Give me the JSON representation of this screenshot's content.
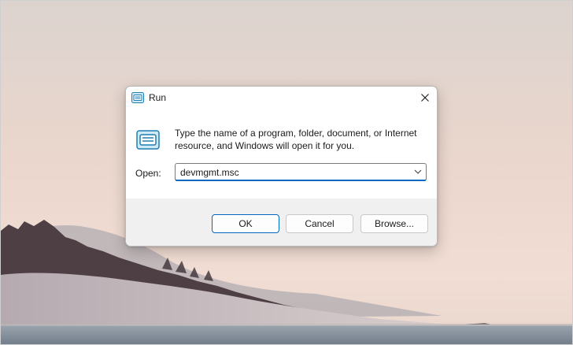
{
  "window": {
    "title": "Run",
    "title_icon": "run-icon",
    "close_icon": "close-icon"
  },
  "dialog": {
    "prompt": "Type the name of a program, folder, document, or Internet resource, and Windows will open it for you.",
    "icon": "run-icon",
    "open_label": "Open:",
    "open_value": "devmgmt.msc",
    "dropdown_icon": "chevron-down-icon"
  },
  "buttons": {
    "ok": "OK",
    "cancel": "Cancel",
    "browse": "Browse..."
  },
  "colors": {
    "accent": "#0067c0",
    "footer": "#f0f0f0"
  }
}
